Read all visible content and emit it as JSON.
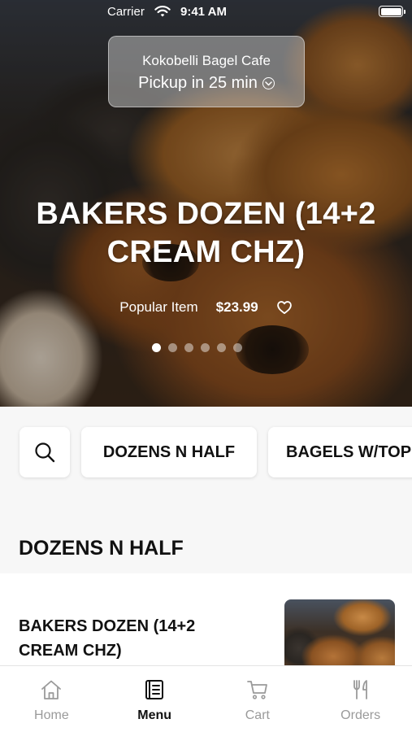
{
  "status_bar": {
    "carrier": "Carrier",
    "time": "9:41 AM"
  },
  "pickup": {
    "restaurant": "Kokobelli Bagel Cafe",
    "label": "Pickup in 25 min"
  },
  "featured": {
    "title": "BAKERS DOZEN (14+2 CREAM CHZ)",
    "tag": "Popular Item",
    "price": "$23.99",
    "carousel_count": 6,
    "carousel_active": 1
  },
  "categories": [
    "DOZENS N HALF",
    "BAGELS W/TOPPINGS"
  ],
  "section": {
    "title": "DOZENS N HALF"
  },
  "items": [
    {
      "name": "BAKERS DOZEN (14+2 CREAM CHZ)"
    }
  ],
  "tabs": [
    {
      "label": "Home",
      "icon": "home-icon"
    },
    {
      "label": "Menu",
      "icon": "menu-icon",
      "active": true
    },
    {
      "label": "Cart",
      "icon": "cart-icon"
    },
    {
      "label": "Orders",
      "icon": "utensils-icon"
    }
  ],
  "colors": {
    "text": "#111111",
    "inactive": "#9a9a9a",
    "background": "#f7f7f7"
  }
}
